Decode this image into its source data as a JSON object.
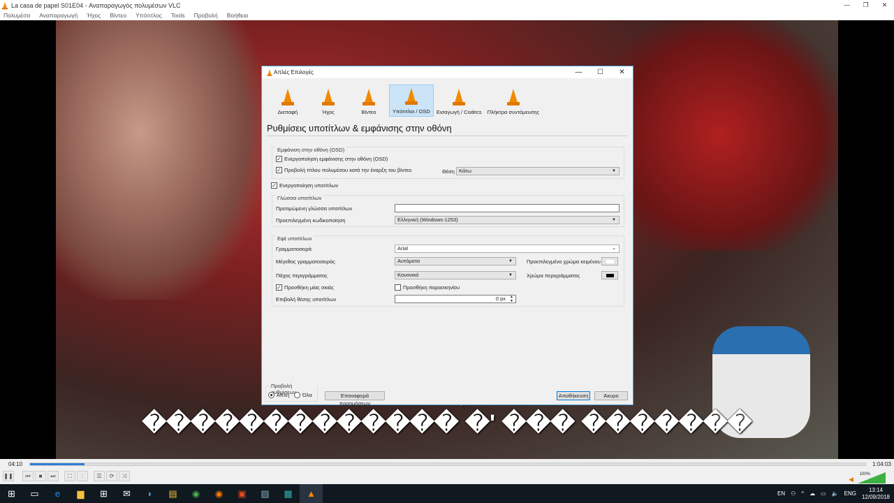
{
  "window": {
    "title": "La casa de papel S01E04 - Αναπαραγωγός πολυμέσων VLC"
  },
  "menu": [
    "Πολυμέσα",
    "Αναπαραγωγή",
    "Ήχος",
    "Βίντεο",
    "Υπότιτλος",
    "Tools",
    "Προβολή",
    "Βοήθεια"
  ],
  "subtitles": {
    "line1": "�                                           ,",
    "line2": "������������� �' ��� �������"
  },
  "player": {
    "elapsed": "04:10",
    "total": "1:04:03",
    "progress_percent": 6.5,
    "volume": "100%"
  },
  "taskbar": {
    "lang": "EN",
    "lang2": "ENG",
    "time": "13:14",
    "date": "12/09/2018"
  },
  "dialog": {
    "title": "Απλές Επιλογές",
    "categories": [
      "Διεπαφή",
      "Ήχος",
      "Βίντεο",
      "Υπότιτλοι / OSD",
      "Εισαγωγή / Codecs",
      "Πλήκτρα συντόμευσης"
    ],
    "heading": "Ρυθμίσεις υποτίτλων & εμφάνισης στην οθόνη",
    "osd": {
      "label": "Εμφάνιση στην οθόνη (OSD)",
      "enable": "Ενεργοποίηση εμφάνισης στην οθόνη (OSD)",
      "show_title": "Προβολή τίτλου πολυμέσου κατά την έναρξη του βίντεο",
      "position_label": "Θέση",
      "position_value": "Κάτω"
    },
    "enable_subs": "Ενεργοποίηση υποτίτλων",
    "lang": {
      "label": "Γλώσσα υποτίτλων",
      "preferred_label": "Προτιμώμενη γλώσσα υποτίτλων",
      "preferred_value": "",
      "encoding_label": "Προεπιλεγμένη κωδικοποίηση",
      "encoding_value": "Ελληνική (Windows-1253)"
    },
    "effects": {
      "label": "Εφέ υποτίτλων",
      "font_label": "Γραμματοσειρά",
      "font_value": "Arial",
      "size_label": "Μέγεθος γραμματοσειράς",
      "size_value": "Αυτόματα",
      "text_color_label": "Προεπιλεγμένο χρώμα κειμένου",
      "text_color": "#ffffff",
      "outline_label": "Πάχος περιγράμματος",
      "outline_value": "Κανονικό",
      "outline_color_label": "Χρώμα περιγράμματος",
      "outline_color": "#000000",
      "shadow": "Προσθήκη μίας σκιάς",
      "background": "Προσθήκη παρασκηνίου",
      "force_pos_label": "Επιβολή θέσης υποτίτλων",
      "force_pos_value": "0 px"
    },
    "show_settings": {
      "label": "Προβολή ρυθμίσεων",
      "simple": "Απλή",
      "all": "Όλα"
    },
    "reset": "Επαναφορά προτιμήσεων",
    "save": "Αποθήκευση",
    "cancel": "Άκυρο"
  }
}
